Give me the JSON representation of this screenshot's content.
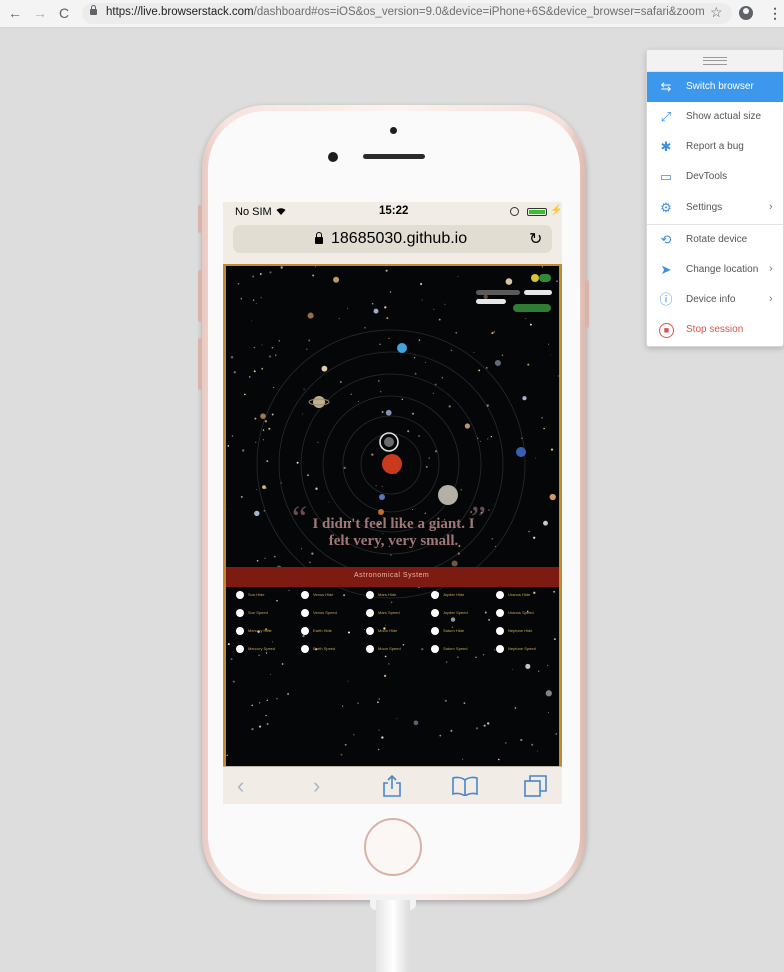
{
  "browser": {
    "url_host": "https://live.browserstack.com",
    "url_path": "/dashboard#os=iOS&os_version=9.0&device=iPhone+6S&device_browser=safari&zoom_t...",
    "back_icon": "←",
    "forward_icon": "→",
    "reload_icon": "C",
    "star_icon": "☆",
    "menu_icon": "⋮"
  },
  "device": {
    "status": {
      "carrier": "No SIM",
      "time": "15:22",
      "charging_icon": "⚡"
    },
    "address": "18685030.github.io",
    "reload_icon": "↻",
    "webpage": {
      "quote": "I didn't feel like a giant. I felt very, very small.",
      "ribbon": "Astronomical System",
      "controls": [
        [
          "Sun Hide",
          "Venus Hide",
          "Mars Hide",
          "Jupiter Hide",
          "Uranus Hide"
        ],
        [
          "Sun Speed",
          "Venus Speed",
          "Mars Speed",
          "Jupiter Speed",
          "Uranus Speed"
        ],
        [
          "Mercury Hide",
          "Earth Hide",
          "Moon Hide",
          "Saturn Hide",
          "Neptune Hide"
        ],
        [
          "Mercury Speed",
          "Earth Speed",
          "Moon Speed",
          "Saturn Speed",
          "Neptune Speed"
        ]
      ]
    },
    "toolbar": {
      "back": "‹",
      "forward": "›"
    }
  },
  "menu": {
    "items": [
      {
        "label": "Switch browser",
        "icon": "⇆"
      },
      {
        "label": "Show actual size",
        "icon": "⤢"
      },
      {
        "label": "Report a bug",
        "icon": "✱"
      },
      {
        "label": "DevTools",
        "icon": "▭"
      },
      {
        "label": "Settings",
        "icon": "⚙"
      },
      {
        "label": "Rotate device",
        "icon": "⟲"
      },
      {
        "label": "Change location",
        "icon": "➤"
      },
      {
        "label": "Device info",
        "icon": "ⓘ"
      },
      {
        "label": "Stop session",
        "icon": "■"
      }
    ],
    "chevron": "›",
    "accent_color": "#3d97ec",
    "danger_color": "#d9534f"
  }
}
